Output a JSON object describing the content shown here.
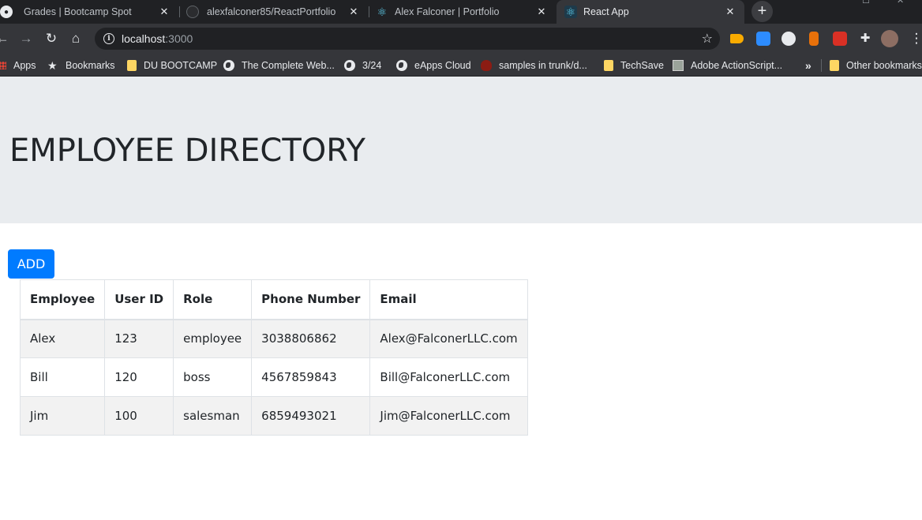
{
  "browser": {
    "tabs": [
      {
        "title": "Grades | Bootcamp Spot",
        "icon": "globe-icon"
      },
      {
        "title": "alexfalconer85/ReactPortfolio",
        "icon": "github-icon"
      },
      {
        "title": "Alex Falconer | Portfolio",
        "icon": "react-icon"
      },
      {
        "title": "React App",
        "icon": "react-icon",
        "active": true
      }
    ],
    "new_tab": "+",
    "address": {
      "host": "localhost",
      "port": ":3000"
    },
    "bookmarks": [
      {
        "label": "Apps",
        "icon": "apps-icon"
      },
      {
        "label": "Bookmarks",
        "icon": "star-icon"
      },
      {
        "label": "DU BOOTCAMP",
        "icon": "folder-icon"
      },
      {
        "label": "The Complete Web...",
        "icon": "globe-icon"
      },
      {
        "label": "3/24",
        "icon": "globe-icon"
      },
      {
        "label": "eApps Cloud",
        "icon": "globe-icon"
      },
      {
        "label": "samples in trunk/d...",
        "icon": "svn-icon"
      },
      {
        "label": "TechSave",
        "icon": "folder-icon"
      },
      {
        "label": "Adobe ActionScript...",
        "icon": "page-icon"
      },
      {
        "label": "»",
        "icon": "overflow-icon"
      },
      {
        "label": "Other bookmarks",
        "icon": "folder-icon"
      }
    ]
  },
  "page": {
    "title": "EMPLOYEE DIRECTORY",
    "add_label": "ADD",
    "accent": "#007bff",
    "table": {
      "headers": [
        "Employee",
        "User ID",
        "Role",
        "Phone Number",
        "Email"
      ],
      "rows": [
        [
          "Alex",
          "123",
          "employee",
          "3038806862",
          "Alex@FalconerLLC.com"
        ],
        [
          "Bill",
          "120",
          "boss",
          "4567859843",
          "Bill@FalconerLLC.com"
        ],
        [
          "Jim",
          "100",
          "salesman",
          "6859493021",
          "Jim@FalconerLLC.com"
        ]
      ]
    }
  }
}
